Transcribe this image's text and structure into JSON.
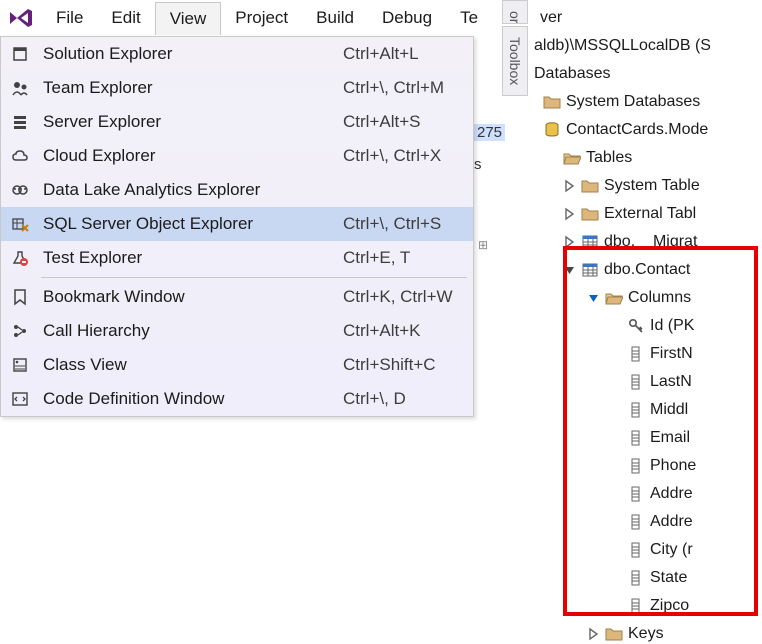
{
  "menubar": {
    "items": [
      {
        "label": "File"
      },
      {
        "label": "Edit"
      },
      {
        "label": "View",
        "open": true
      },
      {
        "label": "Project"
      },
      {
        "label": "Build"
      },
      {
        "label": "Debug"
      },
      {
        "label": "Te"
      }
    ]
  },
  "view_menu": {
    "groups": [
      [
        {
          "icon": "solution-explorer",
          "label": "Solution Explorer",
          "shortcut": "Ctrl+Alt+L"
        },
        {
          "icon": "team-explorer",
          "label": "Team Explorer",
          "shortcut": "Ctrl+\\, Ctrl+M"
        },
        {
          "icon": "server-explorer",
          "label": "Server Explorer",
          "shortcut": "Ctrl+Alt+S"
        },
        {
          "icon": "cloud-explorer",
          "label": "Cloud Explorer",
          "shortcut": "Ctrl+\\, Ctrl+X"
        },
        {
          "icon": "data-lake",
          "label": "Data Lake Analytics Explorer",
          "shortcut": ""
        },
        {
          "icon": "sql-object",
          "label": "SQL Server Object Explorer",
          "shortcut": "Ctrl+\\, Ctrl+S",
          "highlight": true
        },
        {
          "icon": "test-explorer",
          "label": "Test Explorer",
          "shortcut": "Ctrl+E, T"
        }
      ],
      [
        {
          "icon": "bookmark",
          "label": "Bookmark Window",
          "shortcut": "Ctrl+K, Ctrl+W"
        },
        {
          "icon": "call-hierarchy",
          "label": "Call Hierarchy",
          "shortcut": "Ctrl+Alt+K"
        },
        {
          "icon": "class-view",
          "label": "Class View",
          "shortcut": "Ctrl+Shift+C"
        },
        {
          "icon": "code-def",
          "label": "Code Definition Window",
          "shortcut": "Ctrl+\\, D"
        }
      ]
    ]
  },
  "side_tabs": {
    "top_cut": "orer",
    "toolbox": "Toolbox"
  },
  "explorer_tree": {
    "root_cut": "ver",
    "server": "aldb)\\MSSQLLocalDB (S",
    "databases": "Databases",
    "sysdb": "System Databases",
    "db_name": "ContactCards.Mode",
    "tables": "Tables",
    "sys_tables": "System Table",
    "ext_tables": "External Tabl",
    "migrations": "dbo.__Migrat",
    "contact_table": "dbo.Contact",
    "columns_label": "Columns",
    "columns": [
      {
        "icon": "key",
        "label": "Id (PK"
      },
      {
        "icon": "column",
        "label": "FirstN"
      },
      {
        "icon": "column",
        "label": "LastN"
      },
      {
        "icon": "column",
        "label": "Middl"
      },
      {
        "icon": "column",
        "label": "Email"
      },
      {
        "icon": "column",
        "label": "Phone"
      },
      {
        "icon": "column",
        "label": "Addre"
      },
      {
        "icon": "column",
        "label": "Addre"
      },
      {
        "icon": "column",
        "label": "City (r"
      },
      {
        "icon": "column",
        "label": "State"
      },
      {
        "icon": "column",
        "label": "Zipco"
      }
    ],
    "keys": "Keys"
  },
  "bg_fragments": {
    "num": "275",
    "s": "s"
  }
}
